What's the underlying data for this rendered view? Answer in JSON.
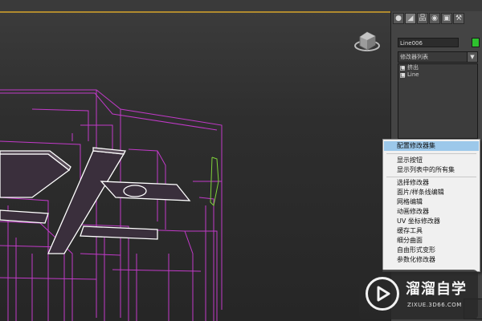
{
  "command_panel": {
    "tabs": [
      {
        "icon": "create-icon",
        "glyph": "●"
      },
      {
        "icon": "modify-icon",
        "glyph": "◢"
      },
      {
        "icon": "hierarchy-icon",
        "glyph": "品"
      },
      {
        "icon": "motion-icon",
        "glyph": "◉"
      },
      {
        "icon": "display-icon",
        "glyph": "▣"
      },
      {
        "icon": "utilities-icon",
        "glyph": "⚒"
      }
    ],
    "object_name": "Line006",
    "object_color": "#2ec02e",
    "modifier_list_label": "修改器列表",
    "stack_items": [
      {
        "label": "挤出",
        "toggle": "●",
        "sub": false
      },
      {
        "label": "Line",
        "toggle": "■",
        "sub": true
      }
    ],
    "stack_tools": [
      {
        "name": "pin-stack-icon",
        "glyph": "⊣"
      },
      {
        "name": "show-end-result-icon",
        "glyph": "Ⅰ"
      },
      {
        "name": "make-unique-icon",
        "glyph": "∀"
      },
      {
        "name": "remove-modifier-icon",
        "glyph": "ä"
      },
      {
        "name": "configure-modifier-sets-icon",
        "glyph": "▤"
      }
    ]
  },
  "context_menu": {
    "items": [
      {
        "label": "配置修改器集",
        "highlight": true
      },
      {
        "separator": true
      },
      {
        "label": "显示按钮"
      },
      {
        "label": "显示列表中的所有集"
      },
      {
        "separator": true
      },
      {
        "label": "选择修改器"
      },
      {
        "label": "面片/样条线编辑"
      },
      {
        "label": "网格编辑"
      },
      {
        "label": "动画修改器"
      },
      {
        "label": "UV 坐标修改器"
      },
      {
        "label": "缓存工具"
      },
      {
        "label": "细分曲面"
      },
      {
        "label": "自由形式变形"
      },
      {
        "label": "参数化修改器"
      }
    ]
  },
  "watermark": {
    "title": "溜溜自学",
    "url": "ZIXUE.3D66.COM"
  },
  "colors": {
    "wireframe": "#c13ac8",
    "selected_edges": "#ffffff",
    "highlight": "#9cc8ea",
    "accent_line": "#b08a2e"
  }
}
